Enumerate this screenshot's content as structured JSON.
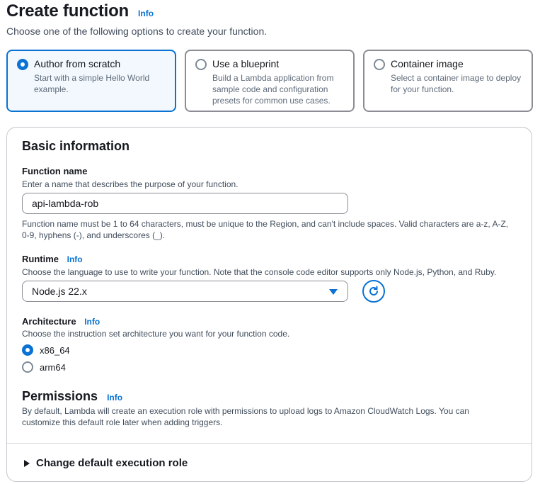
{
  "header": {
    "title": "Create function",
    "info": "Info",
    "subtitle": "Choose one of the following options to create your function."
  },
  "options": [
    {
      "label": "Author from scratch",
      "description": "Start with a simple Hello World example.",
      "selected": true
    },
    {
      "label": "Use a blueprint",
      "description": "Build a Lambda application from sample code and configuration presets for common use cases.",
      "selected": false
    },
    {
      "label": "Container image",
      "description": "Select a container image to deploy for your function.",
      "selected": false
    }
  ],
  "basic": {
    "title": "Basic information",
    "function_name": {
      "label": "Function name",
      "description": "Enter a name that describes the purpose of your function.",
      "value": "api-lambda-rob",
      "constraint": "Function name must be 1 to 64 characters, must be unique to the Region, and can't include spaces. Valid characters are a-z, A-Z, 0-9, hyphens (-), and underscores (_)."
    },
    "runtime": {
      "label": "Runtime",
      "info": "Info",
      "description": "Choose the language to use to write your function. Note that the console code editor supports only Node.js, Python, and Ruby.",
      "value": "Node.js 22.x"
    },
    "architecture": {
      "label": "Architecture",
      "info": "Info",
      "description": "Choose the instruction set architecture you want for your function code.",
      "options": [
        {
          "label": "x86_64",
          "selected": true
        },
        {
          "label": "arm64",
          "selected": false
        }
      ]
    },
    "permissions": {
      "title": "Permissions",
      "info": "Info",
      "description": "By default, Lambda will create an execution role with permissions to upload logs to Amazon CloudWatch Logs. You can customize this default role later when adding triggers."
    },
    "expander": "Change default execution role"
  },
  "colors": {
    "accent": "#0972d3",
    "text": "#16191f",
    "muted": "#5f6b7a"
  }
}
